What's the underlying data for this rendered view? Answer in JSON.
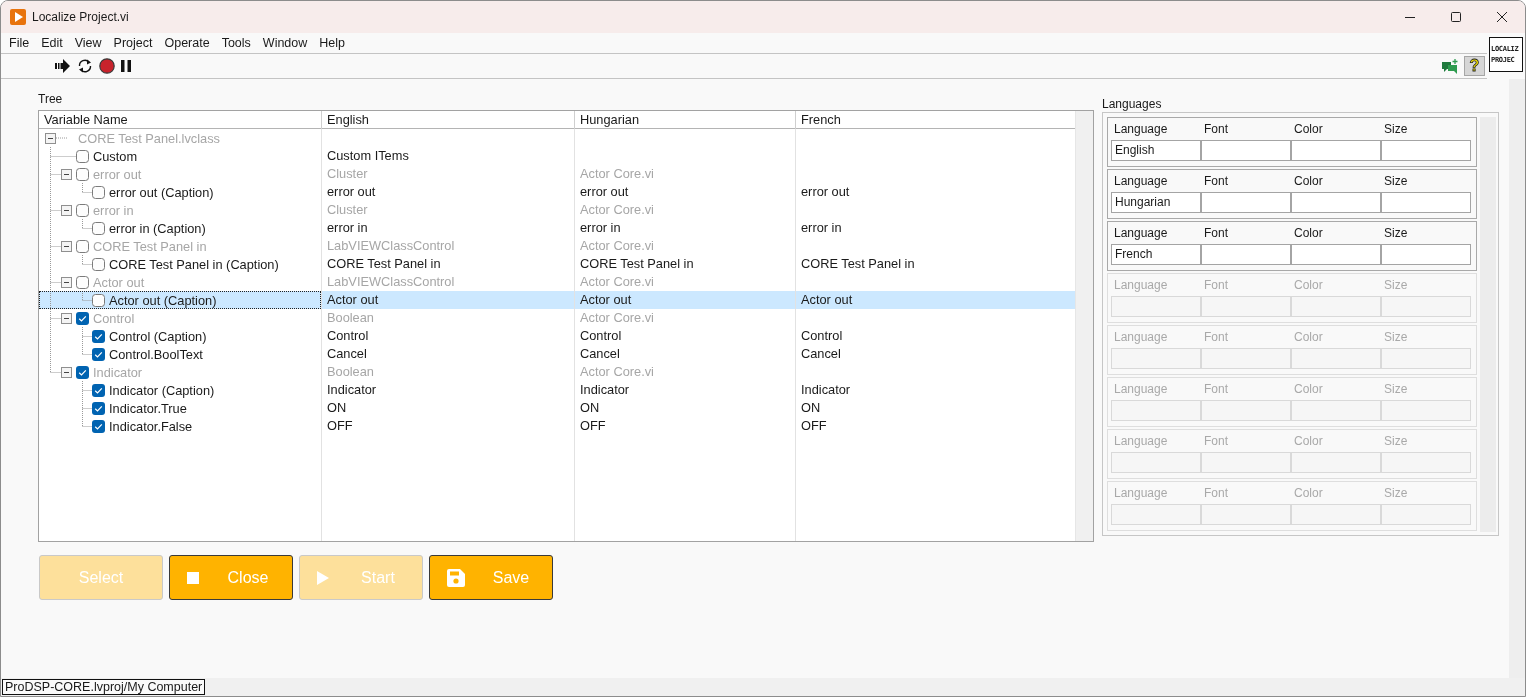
{
  "window": {
    "title": "Localize Project.vi"
  },
  "menu": [
    "File",
    "Edit",
    "View",
    "Project",
    "Operate",
    "Tools",
    "Window",
    "Help"
  ],
  "toolbar": {
    "help": "?",
    "vi_icon": [
      "LOCALIZ",
      "PROJEC"
    ]
  },
  "tree": {
    "label": "Tree",
    "columns": [
      "Variable Name",
      "English",
      "Hungarian",
      "French"
    ],
    "root": {
      "name": "CORE Test Panel.lvclass",
      "expanded": true,
      "disabled": true,
      "selected": false,
      "children": [
        {
          "name": "Custom",
          "checked": false,
          "disabled": false,
          "selected": false,
          "cells": [
            "Custom ITems"
          ]
        },
        {
          "name": "error out",
          "checked": false,
          "disabled": true,
          "selected": false,
          "expanded": true,
          "cells": [
            "Cluster",
            "Actor Core.vi"
          ],
          "children": [
            {
              "name": "error out (Caption)",
              "checked": false,
              "disabled": false,
              "selected": false,
              "cells": [
                "error out",
                "error out",
                "error out"
              ]
            }
          ]
        },
        {
          "name": "error in",
          "checked": false,
          "disabled": true,
          "selected": false,
          "expanded": true,
          "cells": [
            "Cluster",
            "Actor Core.vi"
          ],
          "children": [
            {
              "name": "error in (Caption)",
              "checked": false,
              "disabled": false,
              "selected": false,
              "cells": [
                "error in",
                "error in",
                "error in"
              ]
            }
          ]
        },
        {
          "name": "CORE Test Panel in",
          "checked": false,
          "disabled": true,
          "selected": false,
          "expanded": true,
          "cells": [
            "LabVIEWClassControl",
            "Actor Core.vi"
          ],
          "children": [
            {
              "name": "CORE Test Panel in (Caption)",
              "checked": false,
              "disabled": false,
              "selected": false,
              "cells": [
                "CORE Test Panel in",
                "CORE Test Panel in",
                "CORE Test Panel in"
              ]
            }
          ]
        },
        {
          "name": "Actor out",
          "checked": false,
          "disabled": true,
          "selected": false,
          "expanded": true,
          "cells": [
            "LabVIEWClassControl",
            "Actor Core.vi"
          ],
          "children": [
            {
              "name": "Actor out (Caption)",
              "checked": false,
              "disabled": false,
              "selected": true,
              "cells": [
                "Actor out",
                "Actor out",
                "Actor out"
              ]
            }
          ]
        },
        {
          "name": "Control",
          "checked": true,
          "disabled": true,
          "selected": false,
          "expanded": true,
          "cells": [
            "Boolean",
            "Actor Core.vi"
          ],
          "children": [
            {
              "name": "Control (Caption)",
              "checked": true,
              "disabled": false,
              "selected": false,
              "cells": [
                "Control",
                "Control",
                "Control"
              ]
            },
            {
              "name": "Control.BoolText",
              "checked": true,
              "disabled": false,
              "selected": false,
              "cells": [
                "Cancel",
                "Cancel",
                "Cancel"
              ]
            }
          ]
        },
        {
          "name": "Indicator",
          "checked": true,
          "disabled": true,
          "selected": false,
          "expanded": true,
          "cells": [
            "Boolean",
            "Actor Core.vi"
          ],
          "children": [
            {
              "name": "Indicator (Caption)",
              "checked": true,
              "disabled": false,
              "selected": false,
              "cells": [
                "Indicator",
                "Indicator",
                "Indicator"
              ]
            },
            {
              "name": "Indicator.True",
              "checked": true,
              "disabled": false,
              "selected": false,
              "cells": [
                "ON",
                "ON",
                "ON"
              ]
            },
            {
              "name": "Indicator.False",
              "checked": true,
              "disabled": false,
              "selected": false,
              "cells": [
                "OFF",
                "OFF",
                "OFF"
              ]
            }
          ]
        }
      ]
    }
  },
  "languages": {
    "label": "Languages",
    "entries": [
      {
        "labels": [
          "Language",
          "Font",
          "Color",
          "Size"
        ],
        "language": "English",
        "disabled": false
      },
      {
        "labels": [
          "Language",
          "Font",
          "Color",
          "Size"
        ],
        "language": "Hungarian",
        "disabled": false
      },
      {
        "labels": [
          "Language",
          "Font",
          "Color",
          "Size"
        ],
        "language": "French",
        "disabled": false
      },
      {
        "labels": [
          "Language",
          "Font",
          "Color",
          "Size"
        ],
        "disabled": true
      },
      {
        "labels": [
          "Language",
          "Font",
          "Color",
          "Size"
        ],
        "disabled": true
      },
      {
        "labels": [
          "Language",
          "Font",
          "Color",
          "Size"
        ],
        "disabled": true
      },
      {
        "labels": [
          "Language",
          "Font",
          "Color",
          "Size"
        ],
        "disabled": true
      },
      {
        "labels": [
          "Language",
          "Font",
          "Color",
          "Size"
        ],
        "disabled": true
      }
    ]
  },
  "buttons": [
    {
      "label": "Select",
      "disabled": true
    },
    {
      "label": "Close",
      "disabled": false
    },
    {
      "label": "Start",
      "disabled": true
    },
    {
      "label": "Save",
      "disabled": false
    }
  ],
  "status_bar": "ProDSP-CORE.lvproj/My Computer"
}
